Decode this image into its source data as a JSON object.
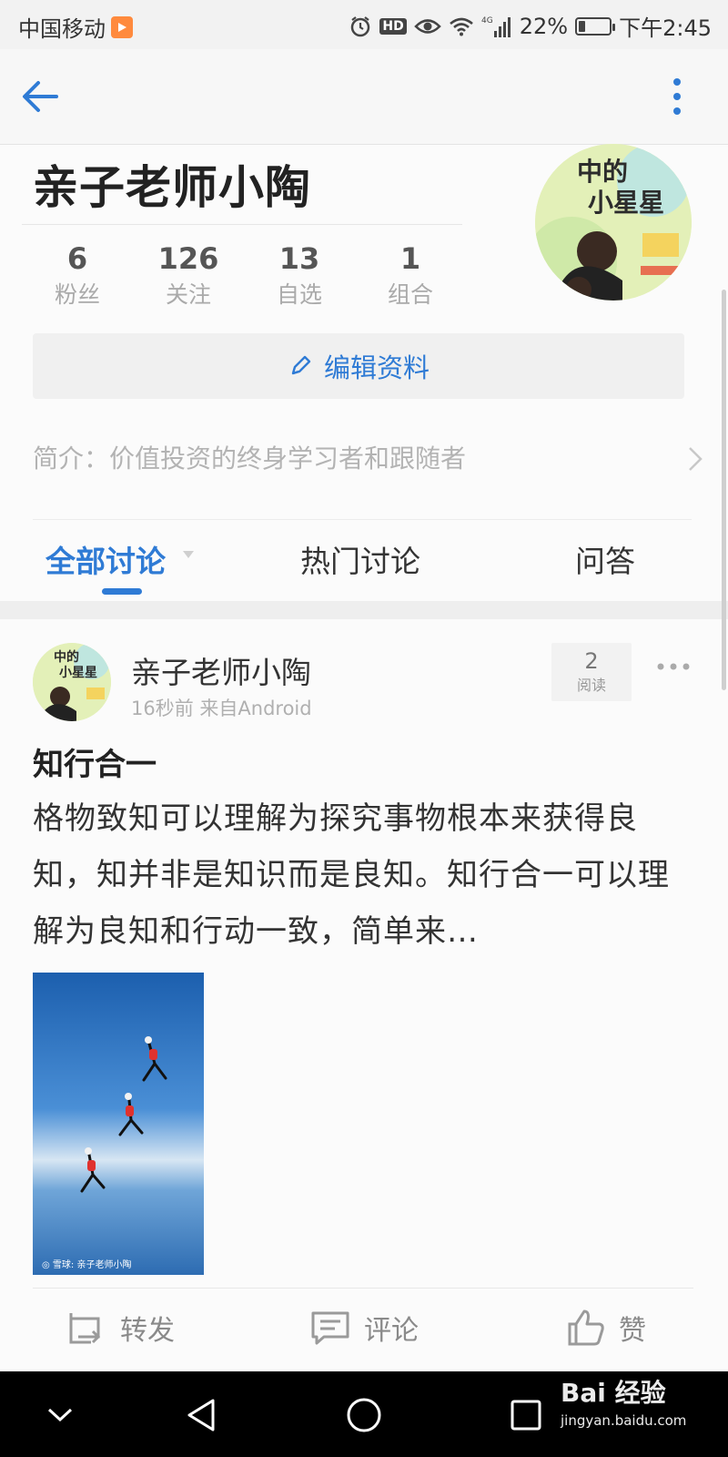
{
  "status_bar": {
    "carrier": "中国移动",
    "hd": "HD",
    "network": "4G",
    "battery": "22%",
    "battery_level": 0.22,
    "time": "下午2:45"
  },
  "header": {
    "back_icon": "arrow-left-icon",
    "more_icon": "vertical-dots-icon"
  },
  "profile": {
    "name": "亲子老师小陶",
    "stats": [
      {
        "value": "6",
        "label": "粉丝"
      },
      {
        "value": "126",
        "label": "关注"
      },
      {
        "value": "13",
        "label": "自选"
      },
      {
        "value": "1",
        "label": "组合"
      }
    ],
    "edit_button": "编辑资料",
    "bio": "简介：价值投资的终身学习者和跟随者"
  },
  "tabs": [
    {
      "label": "全部讨论",
      "active": true
    },
    {
      "label": "热门讨论",
      "active": false
    },
    {
      "label": "问答",
      "active": false
    }
  ],
  "post": {
    "author": "亲子老师小陶",
    "meta": "16秒前  来自Android",
    "read_count": "2",
    "read_label": "阅读",
    "title": "知行合一",
    "body": "格物致知可以理解为探究事物根本来获得良知，知并非是知识而是良知。知行合一可以理解为良知和行动一致，简单来…",
    "actions": {
      "repost": "转发",
      "comment": "评论",
      "like": "赞"
    }
  },
  "watermark": {
    "main": "Bai 经验",
    "sub": "jingyan.baidu.com"
  },
  "colors": {
    "accent": "#2f7bd5",
    "muted": "#b3b3b3"
  }
}
